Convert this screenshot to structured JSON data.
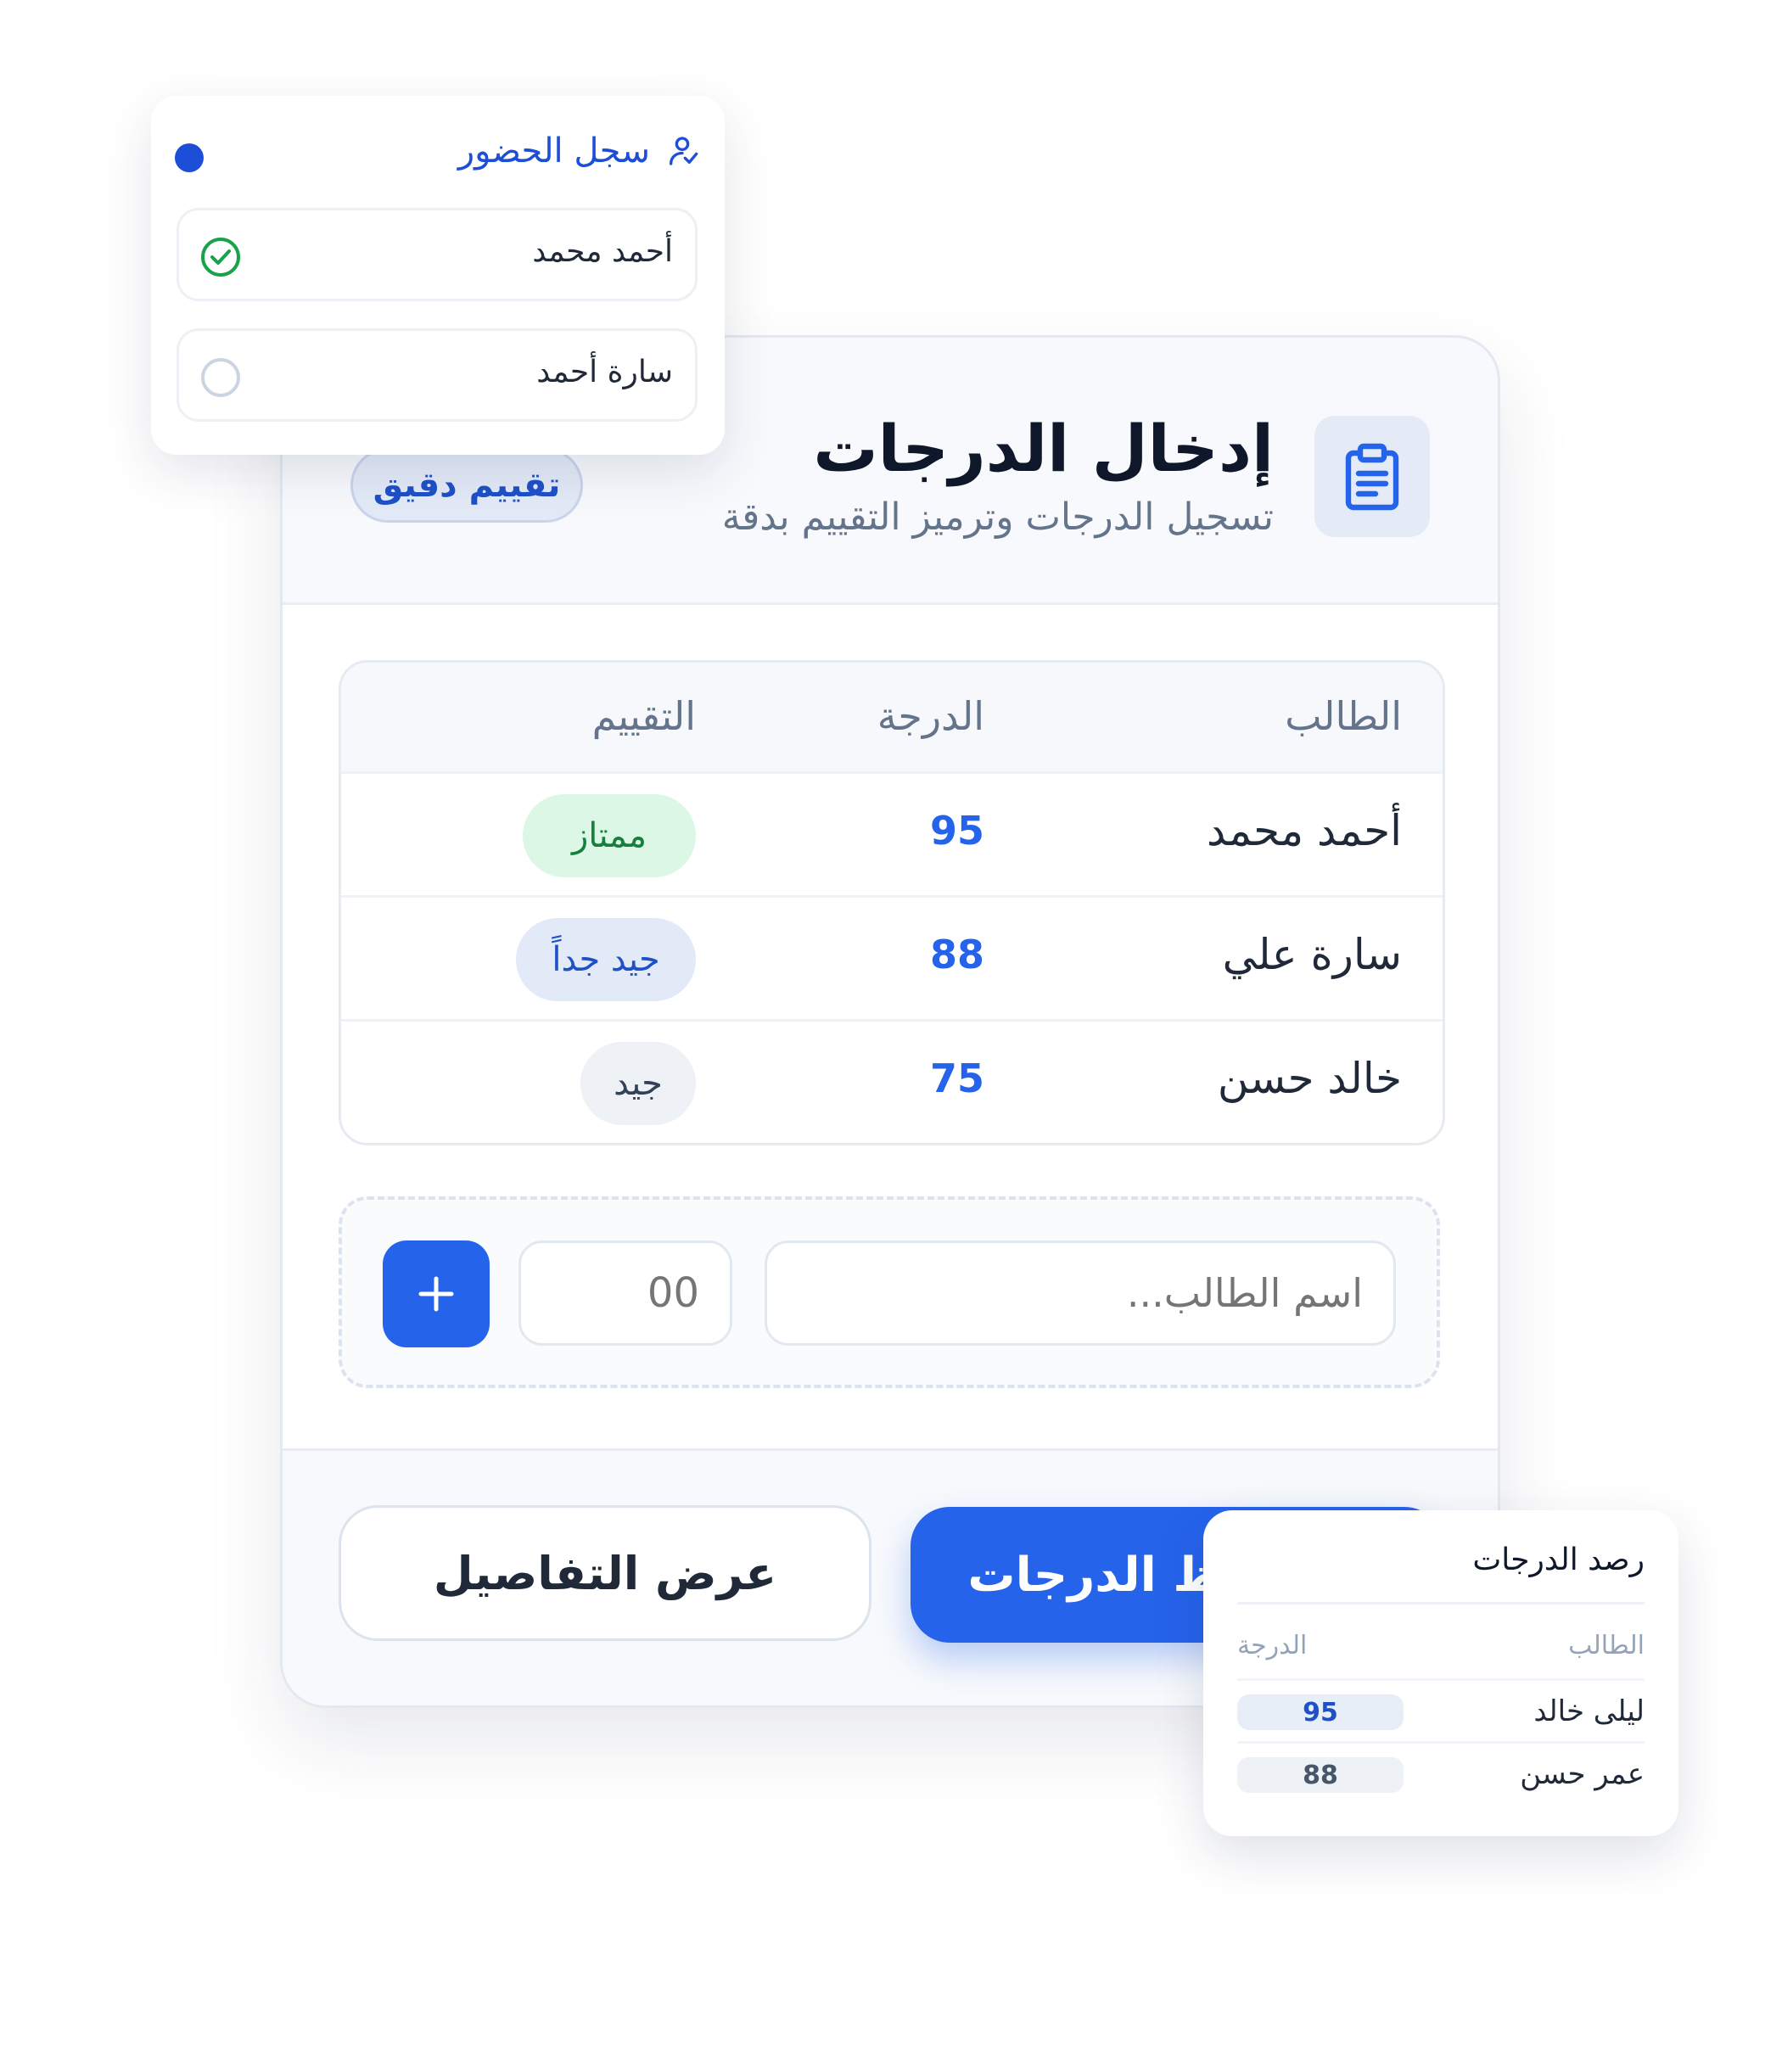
{
  "attendance": {
    "title": "سجل الحضور",
    "students": [
      {
        "name": "أحمد محمد",
        "present": true
      },
      {
        "name": "سارة أحمد",
        "present": false
      }
    ]
  },
  "grades_card": {
    "title": "إدخال الدرجات",
    "subtitle": "تسجيل الدرجات وترميز التقييم بدقة",
    "badge": "تقييم دقيق",
    "columns": {
      "student": "الطالب",
      "grade": "الدرجة",
      "rating": "التقييم"
    },
    "rows": [
      {
        "name": "أحمد محمد",
        "grade": "95",
        "rating": "ممتاز"
      },
      {
        "name": "سارة علي",
        "grade": "88",
        "rating": "جيد جداً"
      },
      {
        "name": "خالد حسن",
        "grade": "75",
        "rating": "جيد"
      }
    ],
    "add_form": {
      "name_placeholder": "اسم الطالب...",
      "grade_placeholder": "00"
    },
    "buttons": {
      "save": "حفظ الدرجات",
      "details": "عرض التفاصيل"
    }
  },
  "summary": {
    "title": "رصد الدرجات",
    "columns": {
      "student": "الطالب",
      "grade": "الدرجة"
    },
    "rows": [
      {
        "name": "ليلى خالد",
        "grade": "95"
      },
      {
        "name": "عمر حسن",
        "grade": "88"
      }
    ]
  },
  "colors": {
    "primary": "#2563eb",
    "success": "#15803d",
    "title": "#0f172a",
    "muted": "#64748b"
  },
  "icons": {
    "header": "clipboard-icon",
    "attendance": "user-check-icon",
    "present": "check-circle-icon",
    "absent": "empty-circle-icon",
    "add": "plus-icon"
  }
}
